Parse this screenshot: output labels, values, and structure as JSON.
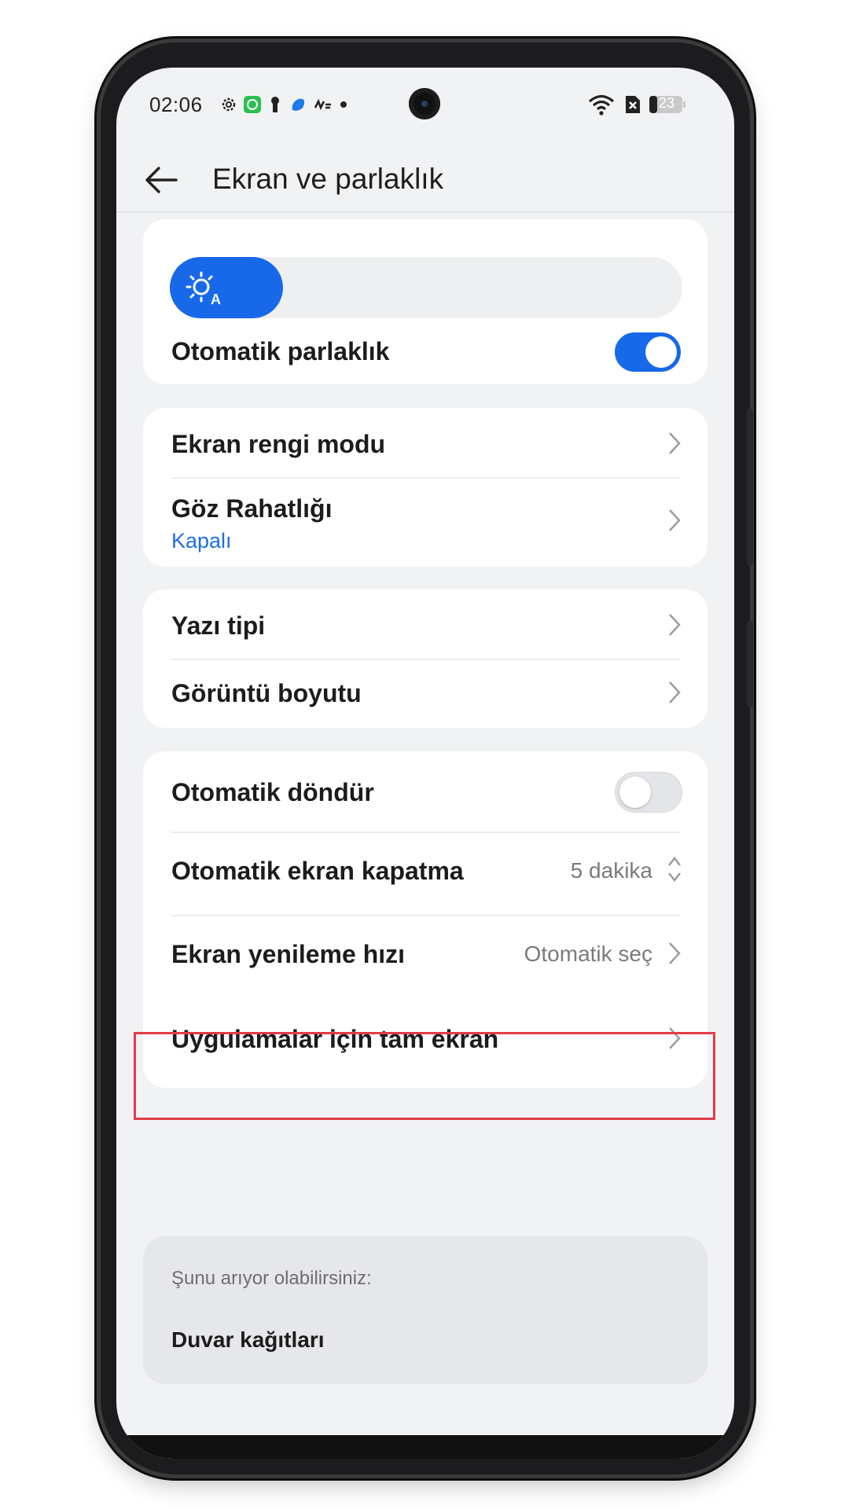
{
  "status_bar": {
    "time": "02:06",
    "battery": "23",
    "left_icons": [
      "settings-icon",
      "app-badge-icon",
      "keyhole-icon",
      "cloud-app-icon",
      "notification-icon",
      "dot-icon"
    ],
    "right_icons": [
      "wifi-icon",
      "sim-off-icon",
      "battery-icon"
    ]
  },
  "header": {
    "title": "Ekran ve parlaklık",
    "back_icon": "back-arrow-icon"
  },
  "brightness_card": {
    "auto_brightness_label": "Otomatik parlaklık",
    "auto_brightness_on": true,
    "slider_icon": "auto-brightness-sun-icon"
  },
  "color_card": {
    "items": [
      {
        "label": "Ekran rengi modu"
      },
      {
        "label": "Göz Rahatlığı",
        "subtitle": "Kapalı"
      }
    ]
  },
  "text_card": {
    "items": [
      {
        "label": "Yazı tipi"
      },
      {
        "label": "Görüntü boyutu"
      }
    ]
  },
  "screen_card": {
    "auto_rotate": {
      "label": "Otomatik döndür",
      "on": false
    },
    "screen_timeout": {
      "label": "Otomatik ekran kapatma",
      "value": "5 dakika"
    },
    "refresh_rate": {
      "label": "Ekran yenileme hızı",
      "value": "Otomatik seç"
    },
    "fullscreen_apps": {
      "label": "Uygulamalar için tam ekran"
    }
  },
  "suggestions": {
    "heading": "Şunu arıyor olabilirsiniz:",
    "items": [
      "Duvar kağıtları"
    ]
  },
  "colors": {
    "accent": "#1769ea",
    "highlight_border": "#e23b4a",
    "subtitle_blue": "#1f6fe0",
    "background": "#f1f2f4"
  }
}
